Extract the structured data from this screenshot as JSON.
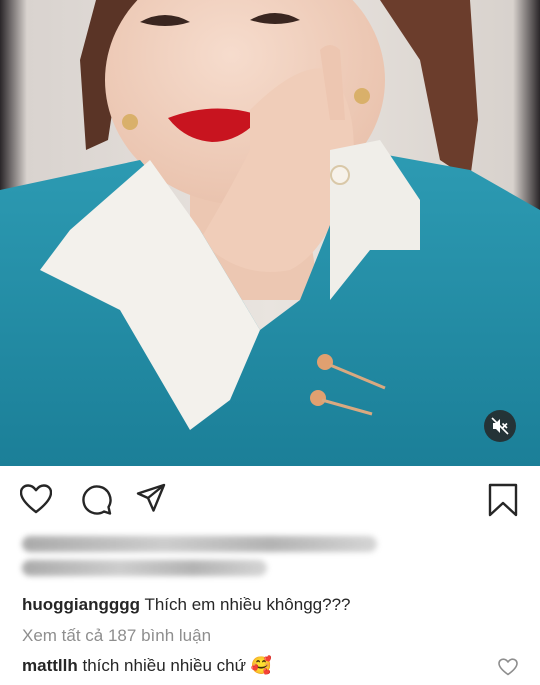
{
  "post": {
    "media_description_icon": "video-post",
    "mute_icon": "speaker-muted-icon"
  },
  "actions": {
    "like_icon": "heart-outline-icon",
    "comment_icon": "comment-bubble-icon",
    "share_icon": "paper-plane-icon",
    "save_icon": "bookmark-outline-icon"
  },
  "caption": {
    "username": "huoggiangggg",
    "text": "Thích em nhiều khôngg???"
  },
  "view_all_comments": "Xem tất cả 187 bình luận",
  "comment": {
    "username": "mattllh",
    "text": "thích nhiều nhiều chứ",
    "emoji": "🥰"
  },
  "colors": {
    "text": "#262626",
    "muted": "#8e8e8e",
    "jacket": "#1f8ea6"
  }
}
